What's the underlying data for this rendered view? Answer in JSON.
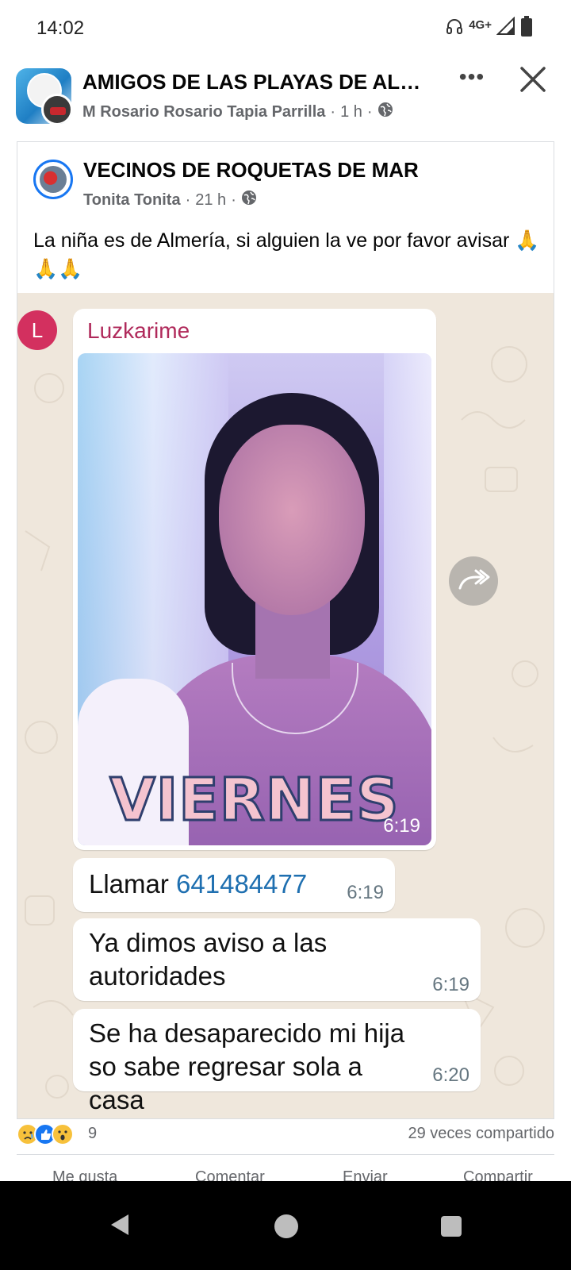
{
  "status_bar": {
    "time": "14:02",
    "network": "4G+",
    "icons": [
      "headphones-icon",
      "signal-icon",
      "battery-icon"
    ]
  },
  "header": {
    "group_name": "AMIGOS DE LAS PLAYAS DE ALM...",
    "author": "M Rosario Rosario Tapia Parrilla",
    "time": "1 h",
    "more_label": "•••",
    "privacy_icon": "globe-icon"
  },
  "shared_post": {
    "page_name": "VECINOS DE ROQUETAS DE MAR",
    "author": "Tonita Tonita",
    "time": "21 h",
    "text": "La niña es de Almería, si alguien la ve por favor avisar 🙏🙏🙏"
  },
  "whatsapp": {
    "sender_initial": "L",
    "sender_name": "Luzkarime",
    "photo_caption": "VIERNES",
    "photo_time": "6:19",
    "messages": [
      {
        "prefix": "Llamar ",
        "phone": "641484477",
        "time": "6:19"
      },
      {
        "text": "Ya dimos aviso a las autoridades",
        "time": "6:19"
      },
      {
        "text": "Se ha desaparecido mi hija so sabe regresar sola a casa",
        "time": "6:20"
      }
    ]
  },
  "engagement": {
    "reaction_count": "9",
    "shares": "29 veces compartido",
    "colors": {
      "like": "#1877f2",
      "emoji": "#f7c13b"
    }
  },
  "actions": [
    "Me gusta",
    "Comentar",
    "Enviar",
    "Compartir"
  ]
}
